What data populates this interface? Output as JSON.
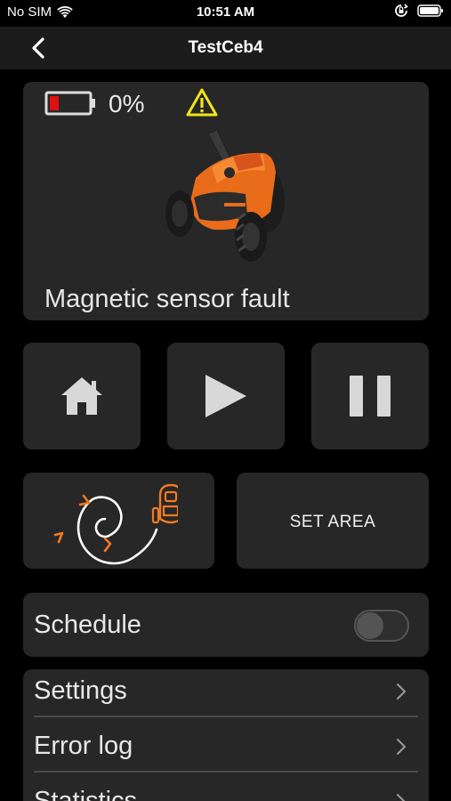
{
  "status_bar": {
    "carrier": "No SIM",
    "time": "10:51 AM"
  },
  "nav": {
    "title": "TestCeb4"
  },
  "device_status": {
    "battery_level": 0,
    "battery_text": "0%",
    "status_message": "Magnetic sensor fault",
    "warning_color": "#f0e41c",
    "battery_color": "#e01010"
  },
  "controls": {
    "icons": [
      "home-icon",
      "play-icon",
      "pause-icon"
    ]
  },
  "set_area": {
    "label": "SET AREA"
  },
  "schedule": {
    "label": "Schedule",
    "enabled": false
  },
  "menu": {
    "items": [
      {
        "label": "Settings"
      },
      {
        "label": "Error log"
      },
      {
        "label": "Statistics"
      }
    ]
  },
  "colors": {
    "accent": "#f47a20",
    "card": "#272727",
    "background": "#000000"
  }
}
